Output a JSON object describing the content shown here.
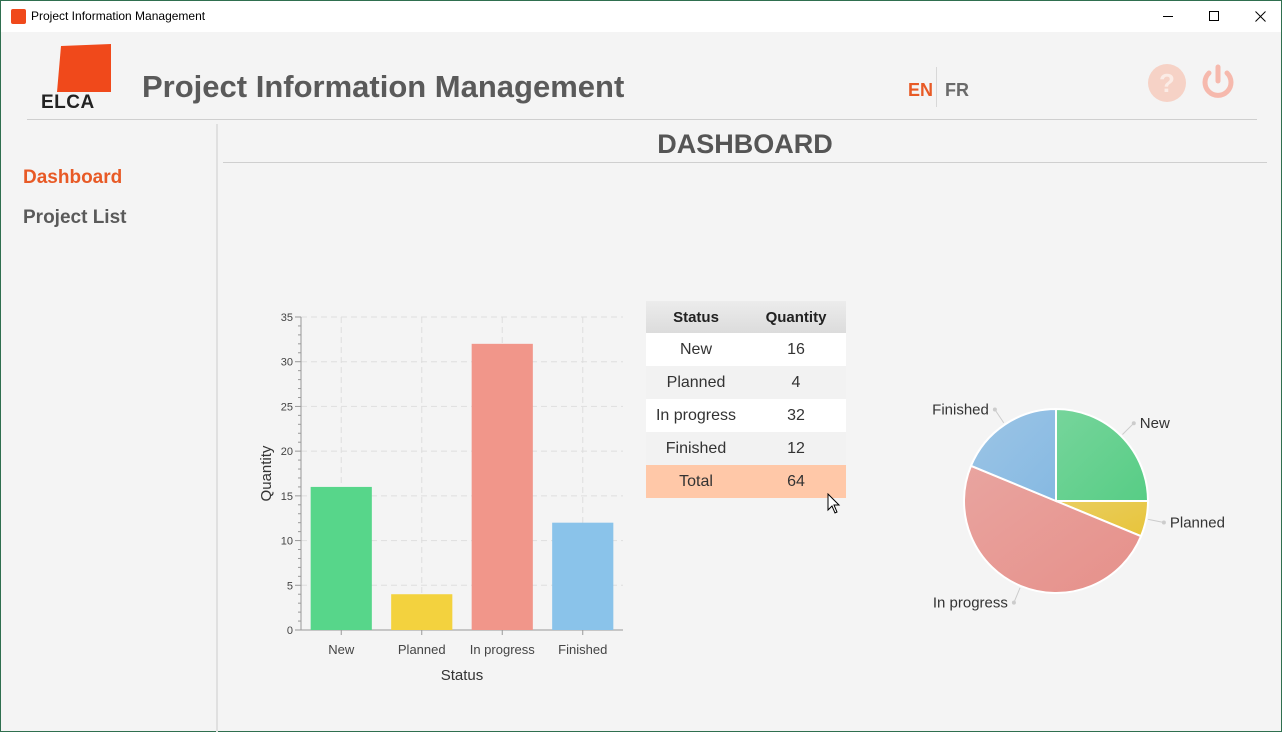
{
  "window": {
    "title": "Project Information Management"
  },
  "header": {
    "logo_text": "ELCA",
    "app_title": "Project Information Management",
    "languages": [
      "EN",
      "FR"
    ],
    "active_language": "EN",
    "accent_color": "#e85a26"
  },
  "sidebar": {
    "items": [
      {
        "label": "Dashboard",
        "active": true
      },
      {
        "label": "Project List",
        "active": false
      }
    ]
  },
  "dashboard": {
    "title": "DASHBOARD"
  },
  "table": {
    "headers": [
      "Status",
      "Quantity"
    ],
    "rows": [
      {
        "status": "New",
        "quantity": "16"
      },
      {
        "status": "Planned",
        "quantity": "4"
      },
      {
        "status": "In progress",
        "quantity": "32"
      },
      {
        "status": "Finished",
        "quantity": "12"
      }
    ],
    "total": {
      "status": "Total",
      "quantity": "64"
    }
  },
  "chart_data": [
    {
      "type": "bar",
      "categories": [
        "New",
        "Planned",
        "In progress",
        "Finished"
      ],
      "values": [
        16,
        4,
        32,
        12
      ],
      "colors": [
        "#57d68a",
        "#f3d23e",
        "#f1968a",
        "#8ac3ea"
      ],
      "xlabel": "Status",
      "ylabel": "Quantity",
      "ylim": [
        0,
        35
      ],
      "yticks": [
        0,
        5,
        10,
        15,
        20,
        25,
        30,
        35
      ],
      "grid": true
    },
    {
      "type": "pie",
      "categories": [
        "New",
        "Planned",
        "In progress",
        "Finished"
      ],
      "values": [
        16,
        4,
        32,
        12
      ],
      "colors": [
        "#57cd85",
        "#e7c43a",
        "#e6908a",
        "#86b9e2"
      ]
    }
  ]
}
